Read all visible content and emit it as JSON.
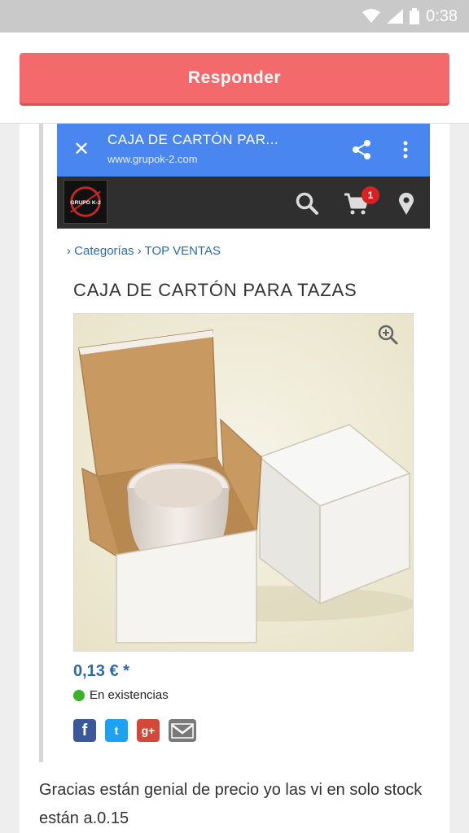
{
  "status_bar": {
    "time": "0:38"
  },
  "reply_button": {
    "label": "Responder"
  },
  "embedded_screenshot": {
    "browser": {
      "page_title": "CAJA DE CARTÓN PAR...",
      "url": "www.grupok-2.com"
    },
    "site_header": {
      "logo_text": "GRUPO K-2",
      "cart_count": "1"
    },
    "breadcrumb": {
      "prefix": "›",
      "item1": "Categorías",
      "sep": "›",
      "item2": "TOP VENTAS"
    },
    "product": {
      "title": "CAJA DE CARTÓN PARA TAZAS",
      "price": "0,13 € *",
      "stock": "En existencias"
    },
    "social": {
      "facebook": "f",
      "twitter": "t",
      "googleplus": "g+"
    }
  },
  "comment": {
    "text": "Gracias están genial de precio yo las vi en solo stock están a.0.15"
  },
  "colors": {
    "reply_button": "#f46a6c",
    "browser_bar": "#4a86f0",
    "site_bar": "#2f2f2f",
    "link": "#2e6aa8",
    "in_stock": "#38b42a"
  }
}
